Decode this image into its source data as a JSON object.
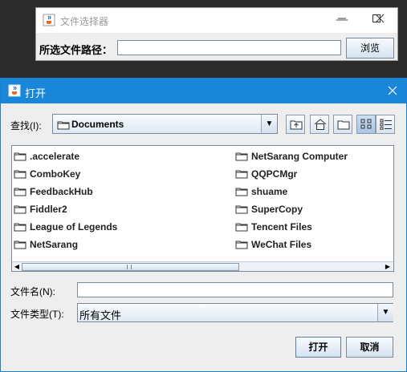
{
  "back_window": {
    "title": "文件选择器",
    "path_label": "所选文件路径：",
    "path_value": "",
    "browse_label": "浏览"
  },
  "dialog": {
    "title": "打开",
    "look_in_label": "查找(I):",
    "look_in_value": "Documents",
    "files": [
      ".accelerate",
      "ComboKey",
      "FeedbackHub",
      "Fiddler2",
      "League of Legends",
      "NetSarang",
      "NetSarang Computer",
      "QQPCMgr",
      "shuame",
      "SuperCopy",
      "Tencent Files",
      "WeChat Files"
    ],
    "filename_label": "文件名(N):",
    "filename_value": "",
    "filetype_label": "文件类型(T):",
    "filetype_value": "所有文件",
    "open_label": "打开",
    "cancel_label": "取消"
  },
  "colors": {
    "title_bar": "#1a86d8",
    "background": "#eeeeee"
  },
  "icons": [
    "java-cup-icon",
    "minimize-icon",
    "maximize-icon",
    "close-icon",
    "folder-icon",
    "up-folder-icon",
    "home-icon",
    "new-folder-icon",
    "list-view-icon",
    "details-view-icon"
  ]
}
